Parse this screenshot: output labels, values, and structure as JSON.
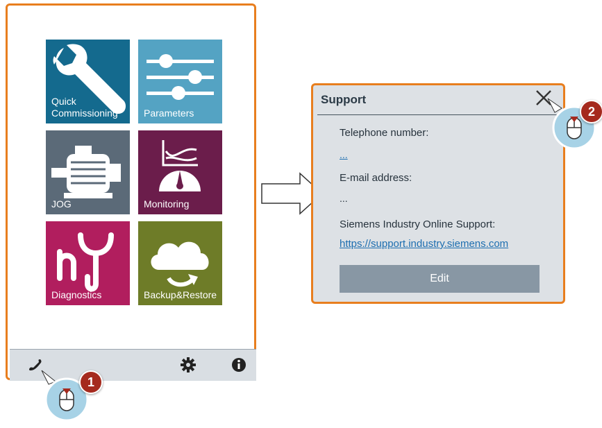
{
  "tiles": [
    {
      "label_lines": [
        "Quick",
        "Commissioning"
      ],
      "color": "#146a8e",
      "icon": "wrench-icon"
    },
    {
      "label_lines": [
        "Parameters"
      ],
      "color": "#54a3c3",
      "icon": "sliders-icon"
    },
    {
      "label_lines": [
        "JOG"
      ],
      "color": "#5b6a78",
      "icon": "motor-icon"
    },
    {
      "label_lines": [
        "Monitoring"
      ],
      "color": "#6b1d4b",
      "icon": "gauge-chart-icon"
    },
    {
      "label_lines": [
        "Diagnostics"
      ],
      "color": "#b11e5e",
      "icon": "diagnostics-icon"
    },
    {
      "label_lines": [
        "Backup&Restore"
      ],
      "color": "#6e7c28",
      "icon": "cloud-sync-icon"
    }
  ],
  "bottombar": {
    "icons": [
      "phone-icon",
      "gear-icon",
      "info-icon"
    ]
  },
  "dialog": {
    "title": "Support",
    "telephone_label": "Telephone number:",
    "telephone_value": "...",
    "email_label": "E-mail address:",
    "email_value": "...",
    "online_support_label": "Siemens Industry Online Support:",
    "online_support_link": "https://support.industry.siemens.com",
    "edit_label": "Edit"
  },
  "callouts": [
    {
      "number": "1"
    },
    {
      "number": "2"
    }
  ],
  "colors": {
    "accent_border": "#e87e1e",
    "badge": "#a52a1e",
    "callout_fill": "#a7d2e6"
  }
}
